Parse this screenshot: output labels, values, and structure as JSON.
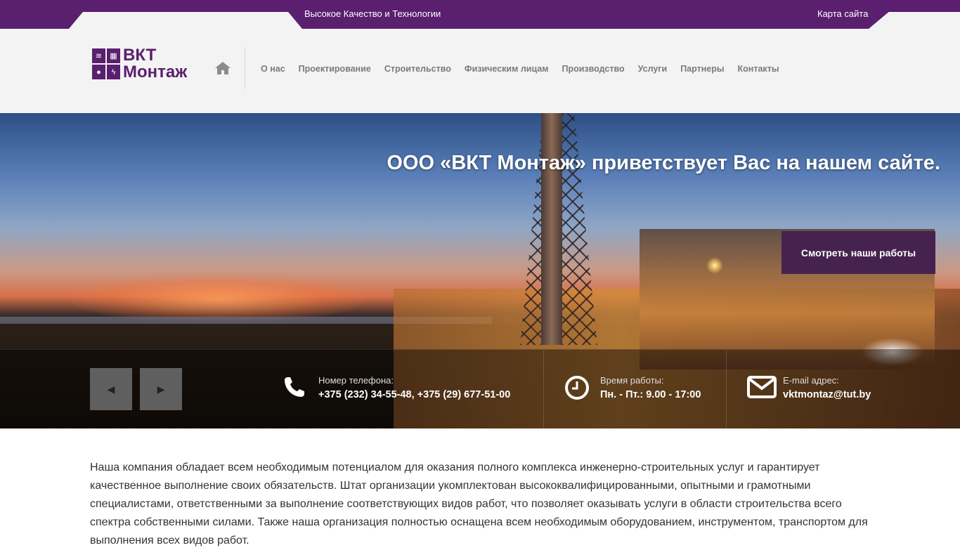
{
  "topbar": {
    "tagline": "Высокое Качество и Технологии",
    "sitemap": "Карта сайта"
  },
  "logo": {
    "line1": "ВКТ",
    "line2": "Монтаж",
    "color": "#5a1f6e"
  },
  "nav": {
    "home_icon": "home-icon",
    "items": [
      "О нас",
      "Проектирование",
      "Строительство",
      "Физическим лицам",
      "Производство",
      "Услуги",
      "Партнеры",
      "Контакты"
    ]
  },
  "hero": {
    "welcome": "ООО «ВКТ Монтаж» приветствует Вас на нашем сайте.",
    "cta": "Смотреть наши работы",
    "prev_icon": "chevron-left-icon",
    "next_icon": "chevron-right-icon"
  },
  "info": {
    "phone": {
      "label": "Номер телефона:",
      "value": "+375 (232) 34-55-48, +375 (29) 677-51-00",
      "icon": "phone-icon"
    },
    "hours": {
      "label": "Время работы:",
      "value": "Пн. - Пт.: 9.00 - 17:00",
      "icon": "clock-icon"
    },
    "email": {
      "label": "E-mail адрес:",
      "value": "vktmontaz@tut.by",
      "icon": "envelope-icon"
    }
  },
  "content": {
    "text": "Наша компания обладает всем необходимым потенциалом для оказания полного комплекса инженерно-строительных услуг и гарантирует качественное выполнение своих обязательств. Штат организации укомплектован высококвалифицированными, опытными и грамотными специалистами, ответственными за выполнение соответствующих видов работ, что позволяет оказывать услуги в области строительства всего спектра собственными силами. Также наша организация полностью оснащена всем необходимым оборудованием, инструментом, транспортом для выполнения всех видов работ."
  },
  "colors": {
    "brand_purple": "#5a1f6e",
    "cta_bg": "#46234f"
  }
}
